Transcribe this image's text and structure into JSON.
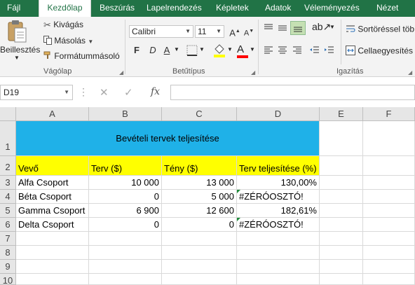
{
  "tabs": [
    "Fájl",
    "Kezdőlap",
    "Beszúrás",
    "Lapelrendezés",
    "Képletek",
    "Adatok",
    "Véleményezés",
    "Nézet"
  ],
  "clipboard": {
    "paste": "Beillesztés",
    "cut": "Kivágás",
    "copy": "Másolás",
    "format_painter": "Formátummásoló",
    "group": "Vágólap"
  },
  "font": {
    "name": "Calibri",
    "size": "11",
    "bold": "F",
    "italic": "D",
    "underline": "A",
    "grow": "A",
    "shrink": "A",
    "font_color": "A",
    "group": "Betűtípus"
  },
  "alignment": {
    "wrap": "Sortöréssel töb",
    "merge": "Cellaegyesítés",
    "group": "Igazítás"
  },
  "formula_bar": {
    "name_box": "D19",
    "fx": "fx",
    "value": ""
  },
  "columns": [
    "A",
    "B",
    "C",
    "D",
    "E",
    "F"
  ],
  "rows": [
    "1",
    "2",
    "3",
    "4",
    "5",
    "6",
    "7",
    "8",
    "9",
    "10"
  ],
  "sheet": {
    "title": "Bevételi tervek teljesítése",
    "headers": [
      "Vevő",
      "Terv ($)",
      "Tény ($)",
      "Terv teljesítése (%)"
    ],
    "data": [
      [
        "Alfa Csoport",
        "10 000",
        "13 000",
        "130,00%"
      ],
      [
        "Béta Csoport",
        "0",
        "5 000",
        "#ZÉRÓOSZTÓ!"
      ],
      [
        "Gamma Csoport",
        "6 900",
        "12 600",
        "182,61%"
      ],
      [
        "Delta Csoport",
        "0",
        "0",
        "#ZÉRÓOSZTÓ!"
      ]
    ]
  },
  "colors": {
    "title_fill": "#1fb1e8",
    "header_fill": "#ffff00",
    "ribbon_green": "#217346",
    "error_marker": "#1e8c3a"
  }
}
